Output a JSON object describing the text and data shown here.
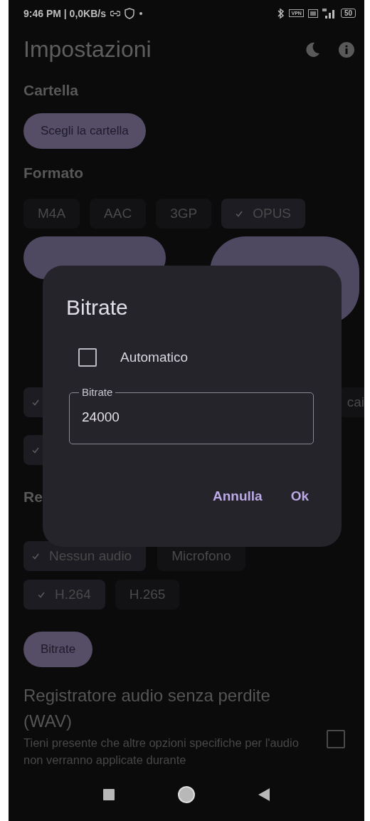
{
  "status_bar": {
    "time": "9:46 PM | 0,0KB/s",
    "vpn": "VPN",
    "battery": "50"
  },
  "header": {
    "title": "Impostazioni"
  },
  "folder": {
    "heading": "Cartella",
    "button": "Scegli la cartella"
  },
  "format": {
    "heading": "Formato",
    "chips": [
      {
        "label": "M4A",
        "selected": false
      },
      {
        "label": "AAC",
        "selected": false
      },
      {
        "label": "3GP",
        "selected": false
      },
      {
        "label": "OPUS",
        "selected": true
      }
    ]
  },
  "options_row_1": [
    {
      "selected": true
    },
    {
      "label": "cai",
      "selected": false
    }
  ],
  "options_row_2": [
    {
      "selected": true
    }
  ],
  "recording": {
    "heading": "Re",
    "audio_chips": [
      {
        "label": "Nessun audio",
        "selected": true
      },
      {
        "label": "Microfono",
        "selected": false
      }
    ],
    "codec_chips": [
      {
        "label": "H.264",
        "selected": true
      },
      {
        "label": "H.265",
        "selected": false
      }
    ],
    "bitrate_button": "Bitrate"
  },
  "lossless": {
    "title": "Registratore audio senza perdite (WAV)",
    "description": "Tieni presente che altre opzioni specifiche per l'audio non verranno applicate durante",
    "checked": false
  },
  "dialog": {
    "title": "Bitrate",
    "checkbox": {
      "label": "Automatico",
      "checked": false
    },
    "field": {
      "label": "Bitrate",
      "value": "24000"
    },
    "buttons": [
      "Annulla",
      "Ok"
    ]
  }
}
